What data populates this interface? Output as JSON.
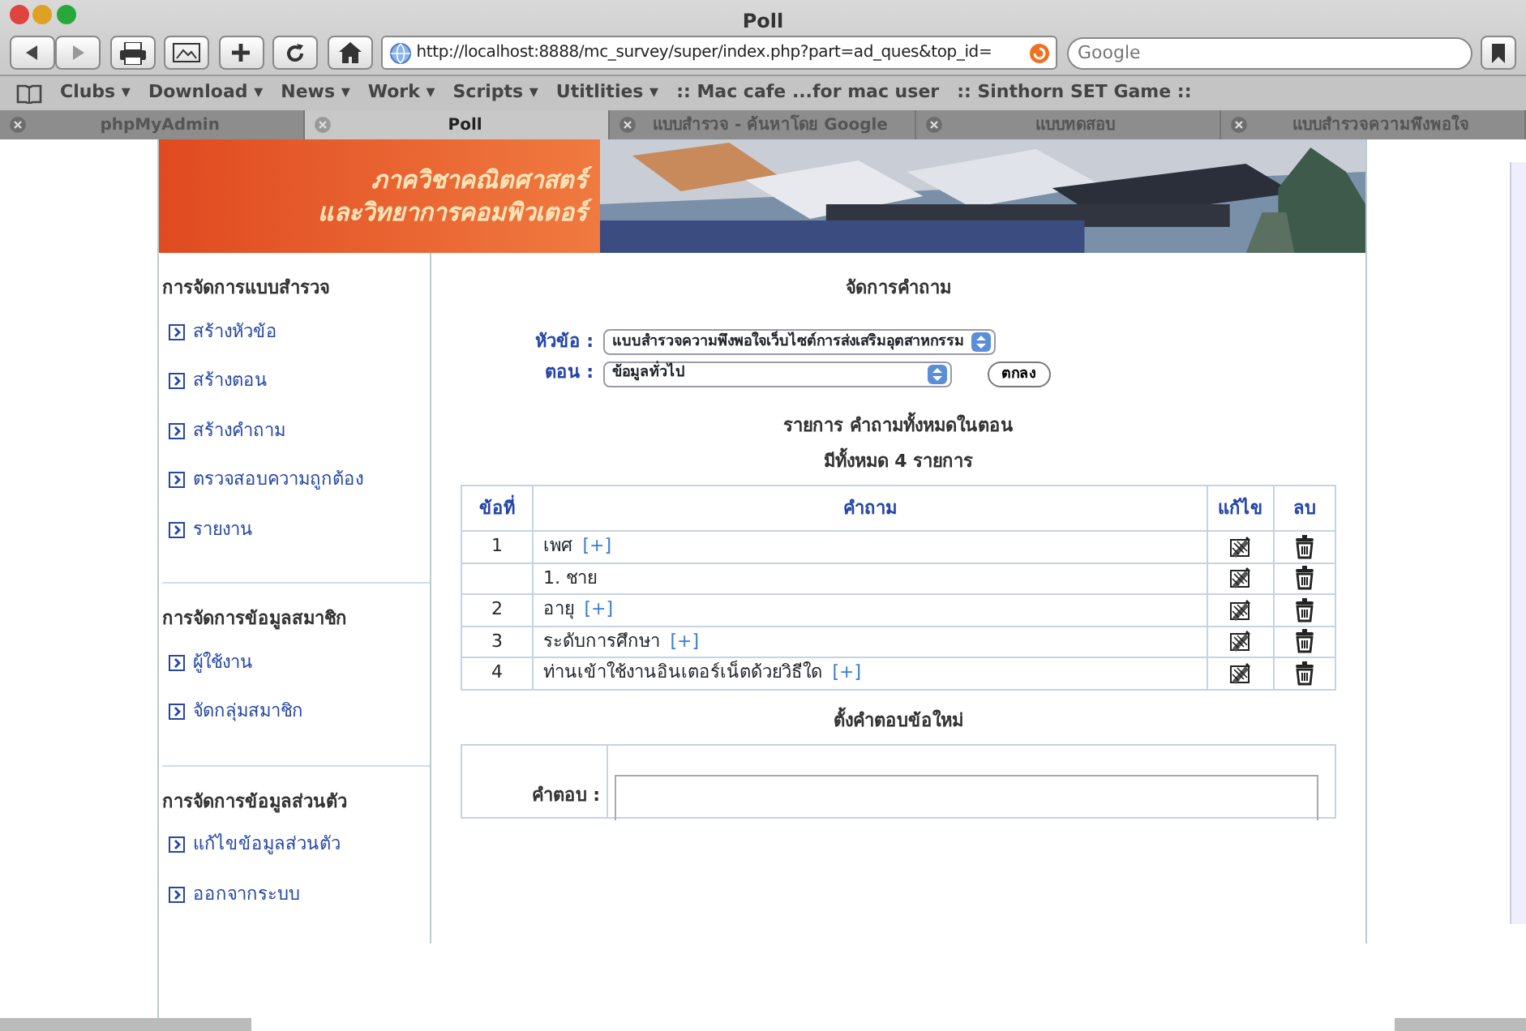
{
  "window": {
    "title": "Poll"
  },
  "toolbar": {
    "url": "http://localhost:8888/mc_survey/super/index.php?part=ad_ques&top_id=",
    "search_placeholder": "Google"
  },
  "bookmarks": [
    "Clubs ▾",
    "Download ▾",
    "News ▾",
    "Work ▾",
    "Scripts ▾",
    "Utitlities ▾",
    ":: Mac cafe ...for mac user",
    ":: Sinthorn SET Game ::"
  ],
  "tabs": [
    {
      "label": "phpMyAdmin",
      "selected": false
    },
    {
      "label": "Poll",
      "selected": true
    },
    {
      "label": "แบบสำรวจ - ค้นหาโดย Google",
      "selected": false
    },
    {
      "label": "แบบทดสอบ",
      "selected": false
    },
    {
      "label": "แบบสำรวจความพึงพอใจ",
      "selected": false
    }
  ],
  "banner": {
    "title_lines": [
      "ภาควิชาคณิตศาสตร์",
      "และวิทยาการคอมพิวเตอร์"
    ]
  },
  "sidebar": {
    "sections": [
      {
        "heading": "การจัดการแบบสำรวจ",
        "items": [
          "สร้างหัวข้อ",
          "สร้างตอน",
          "สร้างคำถาม",
          "ตรวจสอบความถูกต้อง",
          "รายงาน"
        ]
      },
      {
        "heading": "การจัดการข้อมูลสมาชิก",
        "items": [
          "ผู้ใช้งาน",
          "จัดกลุ่มสมาชิก"
        ]
      },
      {
        "heading": "การจัดการข้อมูลส่วนตัว",
        "items": [
          "แก้ไขข้อมูลส่วนตัว",
          "ออกจากระบบ"
        ]
      }
    ]
  },
  "main": {
    "title": "จัดการคำถาม",
    "fields": [
      {
        "label": "หัวข้อ :",
        "value": "แบบสำรวจความพึงพอใจเว็บไซต์การส่งเสริมอุตสาหกรรม"
      },
      {
        "label": "ตอน :",
        "value": "ข้อมูลทั่วไป"
      }
    ],
    "submit": "ตกลง",
    "list_title": "รายการ คำถามทั้งหมดในตอน",
    "count": "มีทั้งหมด 4 รายการ",
    "table": {
      "columns": [
        "ข้อที่",
        "คำถาม",
        "แก้ไข",
        "ลบ"
      ],
      "rows": [
        {
          "kind": "question",
          "number": "1",
          "text": "เพศ",
          "link": "[+]"
        },
        {
          "kind": "answer",
          "text": "1. ชาย"
        },
        {
          "kind": "question",
          "number": "2",
          "text": "อายุ",
          "link": "[+]"
        },
        {
          "kind": "question",
          "number": "3",
          "text": "ระดับการศึกษา",
          "link": "[+]"
        },
        {
          "kind": "question",
          "number": "4",
          "text": "ท่านเข้าใช้งานอินเตอร์เน็ตด้วยวิธีใด",
          "link": "[+]"
        }
      ]
    },
    "new_answer": {
      "title": "ตั้งคำตอบข้อใหม่",
      "label": "คำตอบ :"
    }
  }
}
